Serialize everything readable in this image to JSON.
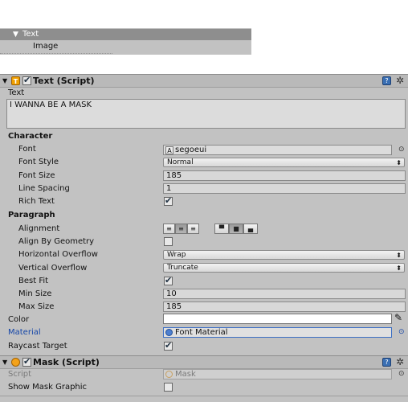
{
  "hierarchy": {
    "selected": "Text",
    "child": "Image"
  },
  "text_component": {
    "title": "Text (Script)",
    "text_label": "Text",
    "text_value": "I WANNA BE A MASK",
    "character_header": "Character",
    "font_label": "Font",
    "font_value": "segoeui",
    "font_style_label": "Font Style",
    "font_style_value": "Normal",
    "font_size_label": "Font Size",
    "font_size_value": "185",
    "line_spacing_label": "Line Spacing",
    "line_spacing_value": "1",
    "rich_text_label": "Rich Text",
    "rich_text_checked": true,
    "paragraph_header": "Paragraph",
    "alignment_label": "Alignment",
    "align_by_geometry_label": "Align By Geometry",
    "align_by_geometry_checked": false,
    "horizontal_overflow_label": "Horizontal Overflow",
    "horizontal_overflow_value": "Wrap",
    "vertical_overflow_label": "Vertical Overflow",
    "vertical_overflow_value": "Truncate",
    "best_fit_label": "Best Fit",
    "best_fit_checked": true,
    "min_size_label": "Min Size",
    "min_size_value": "10",
    "max_size_label": "Max Size",
    "max_size_value": "185",
    "color_label": "Color",
    "color_value": "#ffffff",
    "material_label": "Material",
    "material_value": "Font Material",
    "raycast_target_label": "Raycast Target",
    "raycast_target_checked": true
  },
  "mask_component": {
    "title": "Mask (Script)",
    "script_label": "Script",
    "script_value": "Mask",
    "show_mask_graphic_label": "Show Mask Graphic",
    "show_mask_graphic_checked": false
  },
  "glyphs": {
    "fold": "▼",
    "help": "?",
    "gear": "✲",
    "dropdown_arrow": "⬍",
    "object_selector": "⊙",
    "eyedropper": "✎",
    "text_component_icon": "T",
    "font_field_icon": "A"
  }
}
